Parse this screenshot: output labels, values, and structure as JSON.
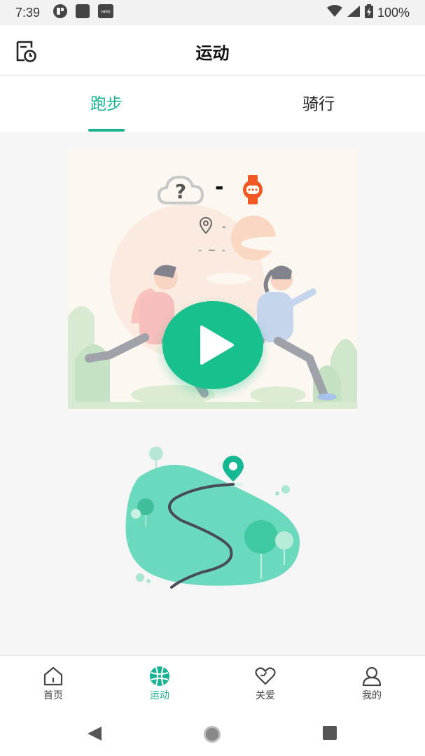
{
  "status_bar": {
    "time": "7:39",
    "icons": [
      "app-notification-icon",
      "square-notification-icon",
      "hms-icon",
      "wifi-icon",
      "signal-icon",
      "battery-icon"
    ],
    "hms_label": "HMS",
    "battery": "100%"
  },
  "app_bar": {
    "title": "运动",
    "history_icon": "history-calendar-icon"
  },
  "tabs": [
    {
      "label": "跑步",
      "active": true
    },
    {
      "label": "骑行",
      "active": false
    }
  ],
  "hero": {
    "weather_icon": "unknown-weather-cloud-icon",
    "temperature": "-",
    "watch_icon": "watch-icon",
    "location_icon": "location-pin-icon",
    "location": "-",
    "range": "- ~ -",
    "play_icon": "play-icon"
  },
  "bottom_nav": [
    {
      "label": "首页",
      "icon": "home-icon",
      "active": false
    },
    {
      "label": "运动",
      "icon": "sport-ball-icon",
      "active": true
    },
    {
      "label": "关爱",
      "icon": "heart-icon",
      "active": false
    },
    {
      "label": "我的",
      "icon": "user-icon",
      "active": false
    }
  ],
  "colors": {
    "accent": "#19b394",
    "play": "#17c08c",
    "watch": "#f05a22",
    "route_blob": "#6bd9bd"
  }
}
